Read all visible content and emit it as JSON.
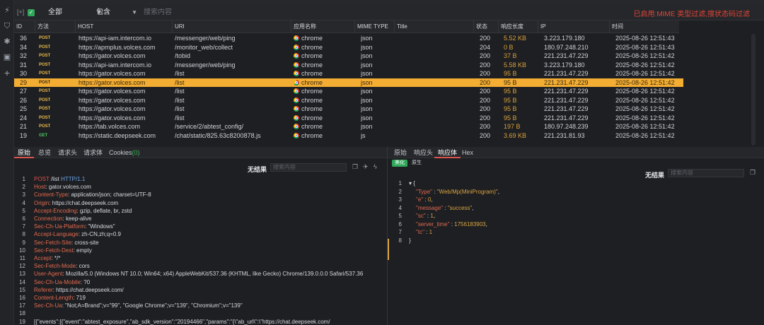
{
  "filter": {
    "scope": "全部",
    "match": "包含",
    "search_placeholder": "搜索内容",
    "status": "已启用:MIME 类型过滤,搜状态码过滤"
  },
  "table": {
    "columns": [
      "ID",
      "方法",
      "HOST",
      "URI",
      "应用名称",
      "MIME TYPE",
      "Title",
      "状态",
      "响应长度",
      "IP",
      "时间"
    ],
    "rows": [
      {
        "id": "36",
        "method": "POST",
        "host": "https://api-iam.intercom.io",
        "uri": "/messenger/web/ping",
        "app": "chrome",
        "mime": "json",
        "status": "200",
        "size": "5.52 KB",
        "ip": "3.223.179.180",
        "time": "2025-08-26 12:51:43"
      },
      {
        "id": "34",
        "method": "POST",
        "host": "https://apmplus.volces.com",
        "uri": "/monitor_web/collect",
        "app": "chrome",
        "mime": "json",
        "status": "204",
        "size": "0 B",
        "ip": "180.97.248.210",
        "time": "2025-08-26 12:51:43"
      },
      {
        "id": "32",
        "method": "POST",
        "host": "https://gator.volces.com",
        "uri": "/tobid",
        "app": "chrome",
        "mime": "json",
        "status": "200",
        "size": "37 B",
        "ip": "221.231.47.229",
        "time": "2025-08-26 12:51:42"
      },
      {
        "id": "31",
        "method": "POST",
        "host": "https://api-iam.intercom.io",
        "uri": "/messenger/web/ping",
        "app": "chrome",
        "mime": "json",
        "status": "200",
        "size": "5.58 KB",
        "ip": "3.223.179.180",
        "time": "2025-08-26 12:51:42"
      },
      {
        "id": "30",
        "method": "POST",
        "host": "https://gator.volces.com",
        "uri": "/list",
        "app": "chrome",
        "mime": "json",
        "status": "200",
        "size": "95 B",
        "ip": "221.231.47.229",
        "time": "2025-08-26 12:51:42"
      },
      {
        "id": "29",
        "method": "POST",
        "host": "https://gator.volces.com",
        "uri": "/list",
        "app": "chrome",
        "mime": "json",
        "status": "200",
        "size": "95 B",
        "ip": "221.231.47.229",
        "time": "2025-08-26 12:51:42"
      },
      {
        "id": "27",
        "method": "POST",
        "host": "https://gator.volces.com",
        "uri": "/list",
        "app": "chrome",
        "mime": "json",
        "status": "200",
        "size": "95 B",
        "ip": "221.231.47.229",
        "time": "2025-08-26 12:51:42"
      },
      {
        "id": "26",
        "method": "POST",
        "host": "https://gator.volces.com",
        "uri": "/list",
        "app": "chrome",
        "mime": "json",
        "status": "200",
        "size": "95 B",
        "ip": "221.231.47.229",
        "time": "2025-08-26 12:51:42"
      },
      {
        "id": "25",
        "method": "POST",
        "host": "https://gator.volces.com",
        "uri": "/list",
        "app": "chrome",
        "mime": "json",
        "status": "200",
        "size": "95 B",
        "ip": "221.231.47.229",
        "time": "2025-08-26 12:51:42"
      },
      {
        "id": "24",
        "method": "POST",
        "host": "https://gator.volces.com",
        "uri": "/list",
        "app": "chrome",
        "mime": "json",
        "status": "200",
        "size": "95 B",
        "ip": "221.231.47.229",
        "time": "2025-08-26 12:51:42"
      },
      {
        "id": "21",
        "method": "POST",
        "host": "https://tab.volces.com",
        "uri": "/service/2/abtest_config/",
        "app": "chrome",
        "mime": "json",
        "status": "200",
        "size": "197 B",
        "ip": "180.97.248.239",
        "time": "2025-08-26 12:51:42"
      },
      {
        "id": "19",
        "method": "GET",
        "host": "https://static.deepseek.com",
        "uri": "/chat/static/825.63c8200878.js",
        "app": "chrome",
        "mime": "js",
        "status": "200",
        "size": "3.69 KB",
        "ip": "221.231.81.93",
        "time": "2025-08-26 12:51:42"
      }
    ],
    "selected_id": "29"
  },
  "request_panel": {
    "tabs": [
      "原始",
      "总览",
      "请求头",
      "请求体",
      "Cookies"
    ],
    "cookies_count": "(0)",
    "no_result": "无结果",
    "search_placeholder": "搜索内容",
    "lines": [
      {
        "n": "1",
        "type": "reqline",
        "method": "POST",
        "path": "/list",
        "ver": "HTTP/1.1"
      },
      {
        "n": "2",
        "k": "Host",
        "v": "gator.volces.com"
      },
      {
        "n": "3",
        "k": "Content-Type",
        "v": "application/json; charset=UTF-8"
      },
      {
        "n": "4",
        "k": "Origin",
        "v": "https://chat.deepseek.com"
      },
      {
        "n": "5",
        "k": "Accept-Encoding",
        "v": "gzip, deflate, br, zstd"
      },
      {
        "n": "6",
        "k": "Connection",
        "v": "keep-alive"
      },
      {
        "n": "7",
        "k": "Sec-Ch-Ua-Platform",
        "v": "\"Windows\""
      },
      {
        "n": "8",
        "k": "Accept-Language",
        "v": "zh-CN,zh;q=0.9"
      },
      {
        "n": "9",
        "k": "Sec-Fetch-Site",
        "v": "cross-site"
      },
      {
        "n": "10",
        "k": "Sec-Fetch-Dest",
        "v": "empty"
      },
      {
        "n": "11",
        "k": "Accept",
        "v": "*/*"
      },
      {
        "n": "12",
        "k": "Sec-Fetch-Mode",
        "v": "cors"
      },
      {
        "n": "13",
        "k": "User-Agent",
        "v": "Mozilla/5.0 (Windows NT 10.0; Win64; x64) AppleWebKit/537.36 (KHTML, like Gecko) Chrome/139.0.0.0 Safari/537.36"
      },
      {
        "n": "14",
        "k": "Sec-Ch-Ua-Mobile",
        "v": "?0"
      },
      {
        "n": "15",
        "k": "Referer",
        "v": "https://chat.deepseek.com/"
      },
      {
        "n": "16",
        "k": "Content-Length",
        "v": "719"
      },
      {
        "n": "17",
        "k": "Sec-Ch-Ua",
        "v": "\"Not;A=Brand\";v=\"99\", \"Google Chrome\";v=\"139\", \"Chromium\";v=\"139\""
      },
      {
        "n": "18",
        "type": "blank"
      },
      {
        "n": "19",
        "type": "body",
        "v": "[{\"events\":[{\"event\":\"abtest_exposure\",\"ab_sdk_version\":\"20194466\",\"params\":\"{\\\"ab_url\\\":\\\"https://chat.deepseek.com/"
      }
    ]
  },
  "response_panel": {
    "tabs": [
      "原始",
      "响应头",
      "响应体",
      "Hex"
    ],
    "active_tab": "响应体",
    "pills": [
      "美化",
      "原生"
    ],
    "no_result": "无结果",
    "search_placeholder": "搜索内容",
    "json": [
      {
        "n": "1",
        "fold": "▾",
        "t": "{"
      },
      {
        "n": "2",
        "k": "\"Type\"",
        "v": "\"Web/Mp(MiniProgram)\"",
        "vt": "s",
        "comma": ","
      },
      {
        "n": "3",
        "k": "\"e\"",
        "v": "0",
        "vt": "n",
        "comma": ","
      },
      {
        "n": "4",
        "k": "\"message\"",
        "v": "\"success\"",
        "vt": "s",
        "comma": ","
      },
      {
        "n": "5",
        "k": "\"sc\"",
        "v": "1",
        "vt": "n",
        "comma": ","
      },
      {
        "n": "6",
        "k": "\"server_time\"",
        "v": "1756183903",
        "vt": "n",
        "comma": ","
      },
      {
        "n": "7",
        "k": "\"tc\"",
        "v": "1",
        "vt": "n",
        "comma": ""
      },
      {
        "n": "8",
        "t": "}"
      }
    ]
  },
  "colors": {
    "selected_row": "#f3ad33",
    "post_method": "#e7b94a",
    "get_method": "#4fc45f",
    "size": "#d8a03a",
    "header_key": "#e26a50",
    "filter_status": "#e0453a",
    "pill_active": "#2fa85a"
  }
}
